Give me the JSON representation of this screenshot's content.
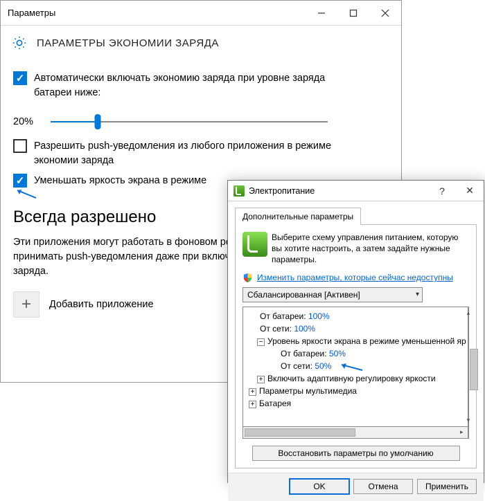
{
  "settings": {
    "window_title": "Параметры",
    "page_title": "ПАРАМЕТРЫ ЭКОНОМИИ ЗАРЯДА",
    "auto_enable_label": "Автоматически включать экономию заряда при уровне заряда батареи ниже:",
    "slider_value": "20%",
    "slider_percent": 20,
    "push_label": "Разрешить push-уведомления из любого приложения в режиме экономии заряда",
    "dim_label": "Уменьшать яркость экрана в режиме",
    "always_allowed_heading": "Всегда разрешено",
    "always_allowed_desc": "Эти приложения могут работать в фоновом режиме, а также отправлять и принимать push-уведомления даже при включенной функции экономии заряда.",
    "add_app_label": "Добавить приложение"
  },
  "power": {
    "window_title": "Электропитание",
    "tab_label": "Дополнительные параметры",
    "description": "Выберите схему управления питанием, которую вы хотите настроить, а затем задайте нужные параметры.",
    "admin_link": "Изменить параметры, которые сейчас недоступны",
    "plan_selected": "Сбалансированная [Активен]",
    "restore_button": "Восстановить параметры по умолчанию",
    "ok_button": "OK",
    "cancel_button": "Отмена",
    "apply_button": "Применить",
    "tree": {
      "n0a_label": "От батареи:",
      "n0a_val": "100%",
      "n0b_label": "От сети:",
      "n0b_val": "100%",
      "n1_label": "Уровень яркости экрана в режиме уменьшенной яр",
      "n1a_label": "От батареи:",
      "n1a_val": "50%",
      "n1b_label": "От сети:",
      "n1b_val": "50%",
      "n2_label": "Включить адаптивную регулировку яркости",
      "n3_label": "Параметры мультимедиа",
      "n4_label": "Батарея"
    }
  }
}
